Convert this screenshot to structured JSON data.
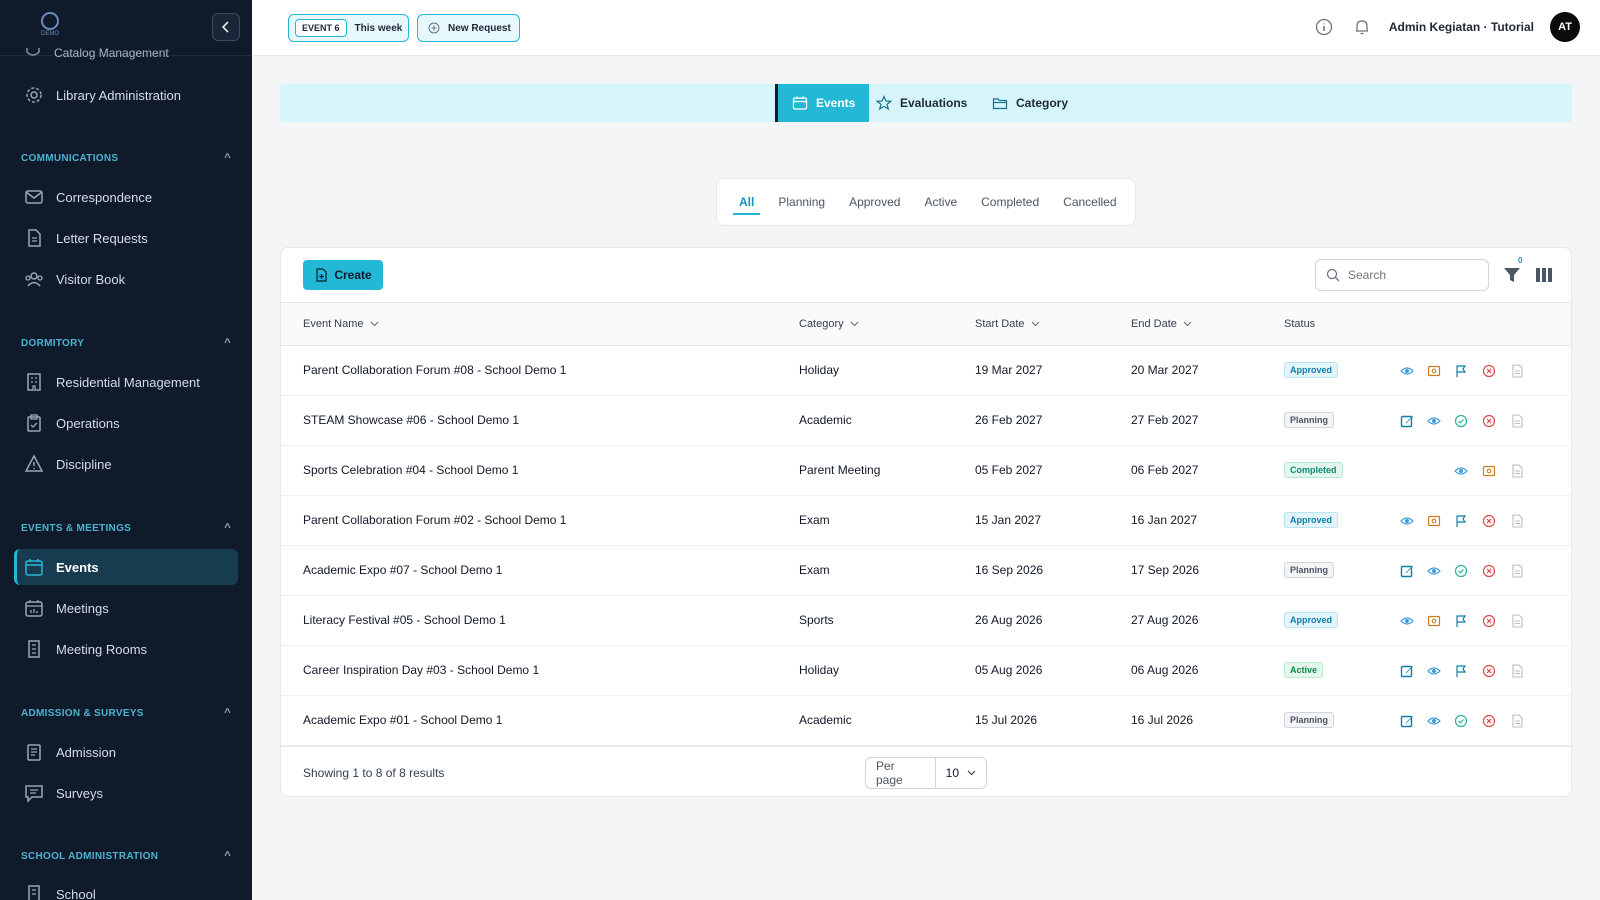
{
  "sidebar": {
    "logo_text": "DEMO",
    "partial_item": "Catalog Management",
    "library_admin": "Library Administration",
    "sections": {
      "communications": "COMMUNICATIONS",
      "dormitory": "DORMITORY",
      "events_meetings": "EVENTS & MEETINGS",
      "admission_surveys": "ADMISSION & SURVEYS",
      "school_admin": "SCHOOL ADMINISTRATION"
    },
    "items": {
      "correspondence": "Correspondence",
      "letter_requests": "Letter Requests",
      "visitor_book": "Visitor Book",
      "residential": "Residential Management",
      "operations": "Operations",
      "discipline": "Discipline",
      "events": "Events",
      "meetings": "Meetings",
      "meeting_rooms": "Meeting Rooms",
      "admission": "Admission",
      "surveys": "Surveys",
      "school": "School"
    }
  },
  "header": {
    "event_badge": "EVENT 6",
    "this_week": "This week",
    "new_request": "New Request",
    "user_name": "Admin Kegiatan · Tutorial",
    "avatar_initials": "AT"
  },
  "module_tabs": [
    "Events",
    "Evaluations",
    "Category"
  ],
  "status_tabs": [
    "All",
    "Planning",
    "Approved",
    "Active",
    "Completed",
    "Cancelled"
  ],
  "toolbar": {
    "create_label": "Create",
    "search_placeholder": "Search",
    "filter_count": "0"
  },
  "table": {
    "columns": [
      "Event Name",
      "Category",
      "Start Date",
      "End Date",
      "Status"
    ],
    "rows": [
      {
        "name": "Parent Collaboration Forum #08 - School Demo 1",
        "category": "Holiday",
        "start": "19 Mar 2027",
        "end": "20 Mar 2027",
        "status": "Approved"
      },
      {
        "name": "STEAM Showcase #06 - School Demo 1",
        "category": "Academic",
        "start": "26 Feb 2027",
        "end": "27 Feb 2027",
        "status": "Planning"
      },
      {
        "name": "Sports Celebration #04 - School Demo 1",
        "category": "Parent Meeting",
        "start": "05 Feb 2027",
        "end": "06 Feb 2027",
        "status": "Completed"
      },
      {
        "name": "Parent Collaboration Forum #02 - School Demo 1",
        "category": "Exam",
        "start": "15 Jan 2027",
        "end": "16 Jan 2027",
        "status": "Approved"
      },
      {
        "name": "Academic Expo #07 - School Demo 1",
        "category": "Exam",
        "start": "16 Sep 2026",
        "end": "17 Sep 2026",
        "status": "Planning"
      },
      {
        "name": "Literacy Festival #05 - School Demo 1",
        "category": "Sports",
        "start": "26 Aug 2026",
        "end": "27 Aug 2026",
        "status": "Approved"
      },
      {
        "name": "Career Inspiration Day #03 - School Demo 1",
        "category": "Holiday",
        "start": "05 Aug 2026",
        "end": "06 Aug 2026",
        "status": "Active"
      },
      {
        "name": "Academic Expo #01 - School Demo 1",
        "category": "Academic",
        "start": "15 Jul 2026",
        "end": "16 Jul 2026",
        "status": "Planning"
      }
    ]
  },
  "footer": {
    "showing": "Showing 1 to 8 of 8 results",
    "per_page_label": "Per page",
    "per_page_value": "10"
  },
  "colors": {
    "accent": "#22b8d6",
    "sidebar_bg": "#0f1a2b",
    "edit": "#0e7fa8",
    "view": "#3b9ad9",
    "approve": "#2bb39a",
    "cancel": "#e04848",
    "report": "#d07b16"
  }
}
